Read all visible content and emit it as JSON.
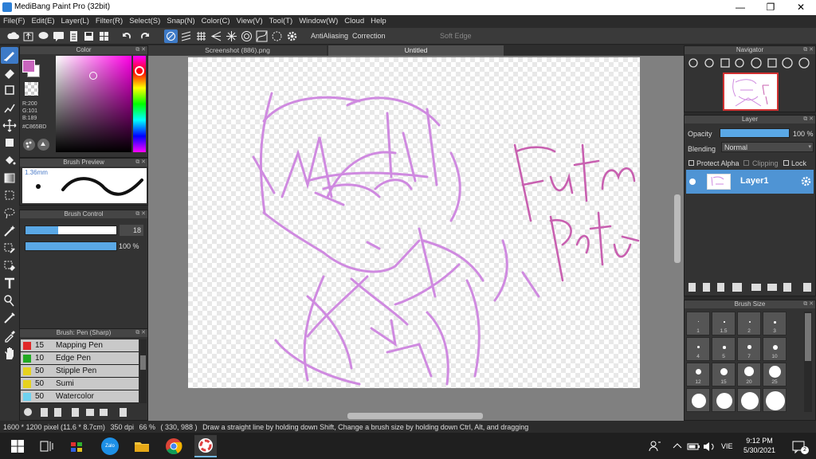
{
  "window": {
    "title": "MediBang Paint Pro (32bit)",
    "minimize": "—",
    "maximize": "❐",
    "close": "✕"
  },
  "menu": [
    "File(F)",
    "Edit(E)",
    "Layer(L)",
    "Filter(R)",
    "Select(S)",
    "Snap(N)",
    "Color(C)",
    "View(V)",
    "Tool(T)",
    "Window(W)",
    "Cloud",
    "Help"
  ],
  "toolbar": {
    "antialiasing_label": "AntiAliasing",
    "correction_label": "Correction",
    "correction_value": "40",
    "soft_edge_label": "Soft Edge"
  },
  "color_panel": {
    "title": "Color",
    "r": "R:200",
    "g": "G:101",
    "b": "B:189",
    "hex": "#C865BD",
    "accent": "#C865BD"
  },
  "brush_preview": {
    "title": "Brush Preview",
    "size": "1.36mm"
  },
  "brush_control": {
    "title": "Brush Control",
    "size_value": "18",
    "opacity_value": "100 %",
    "size_fraction": 0.36,
    "opacity_fraction": 1.0
  },
  "brush_list": {
    "title": "Brush: Pen (Sharp)",
    "items": [
      {
        "size": "15",
        "name": "Mapping Pen",
        "color": "#e02828"
      },
      {
        "size": "10",
        "name": "Edge Pen",
        "color": "#22aa22"
      },
      {
        "size": "50",
        "name": "Stipple Pen",
        "color": "#e6d21e"
      },
      {
        "size": "50",
        "name": "Sumi",
        "color": "#e6d21e"
      },
      {
        "size": "50",
        "name": "Watercolor",
        "color": "#6ed2f0"
      }
    ]
  },
  "tabs": [
    {
      "label": "Screenshot (886).png",
      "active": false
    },
    {
      "label": "Untitled",
      "active": true
    }
  ],
  "navigator": {
    "title": "Navigator"
  },
  "layer_panel": {
    "title": "Layer",
    "opacity_label": "Opacity",
    "opacity_value": "100 %",
    "opacity_fraction": 1.0,
    "blending_label": "Blending",
    "blending_value": "Normal",
    "protect_alpha": "Protect Alpha",
    "clipping": "Clipping",
    "lock": "Lock",
    "layer_name": "Layer1"
  },
  "brush_size_panel": {
    "title": "Brush Size",
    "sizes": [
      "1",
      "1.5",
      "2",
      "3",
      "4",
      "5",
      "7",
      "10",
      "12",
      "15",
      "20",
      "25"
    ]
  },
  "status": {
    "dimensions": "1600 * 1200 pixel  (11.6 * 8.7cm)",
    "dpi": "350 dpi",
    "zoom": "66 %",
    "cursor": "( 330, 988 )",
    "hint": "Draw a straight line by holding down Shift, Change a brush size by holding down Ctrl, Alt, and dragging"
  },
  "taskbar": {
    "language": "VIE",
    "time": "9:12 PM",
    "date": "5/30/2021",
    "notifications": "2",
    "zalo": "Zalo"
  }
}
